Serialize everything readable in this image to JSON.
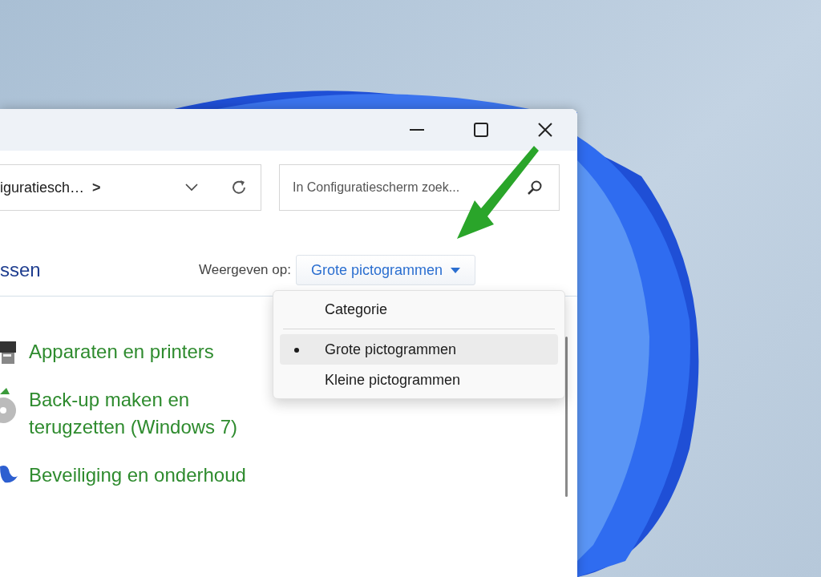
{
  "address_bar": {
    "path": "iguratiesch…",
    "separator": ">"
  },
  "search": {
    "placeholder": "In Configuratiescherm zoek..."
  },
  "heading": "ssen",
  "view_by": {
    "label": "Weergeven op:",
    "value": "Grote pictogrammen"
  },
  "menu": {
    "groups": [
      [
        {
          "label": "Categorie",
          "selected": false
        }
      ],
      [
        {
          "label": "Grote pictogrammen",
          "selected": true
        },
        {
          "label": "Kleine pictogrammen",
          "selected": false
        }
      ]
    ]
  },
  "items": [
    {
      "kind": "printer",
      "label": "Apparaten en printers"
    },
    {
      "kind": "backup",
      "label": "Back-up maken en terugzetten (Windows 7)"
    },
    {
      "kind": "flag",
      "label": "Beveiliging en onderhoud"
    }
  ]
}
